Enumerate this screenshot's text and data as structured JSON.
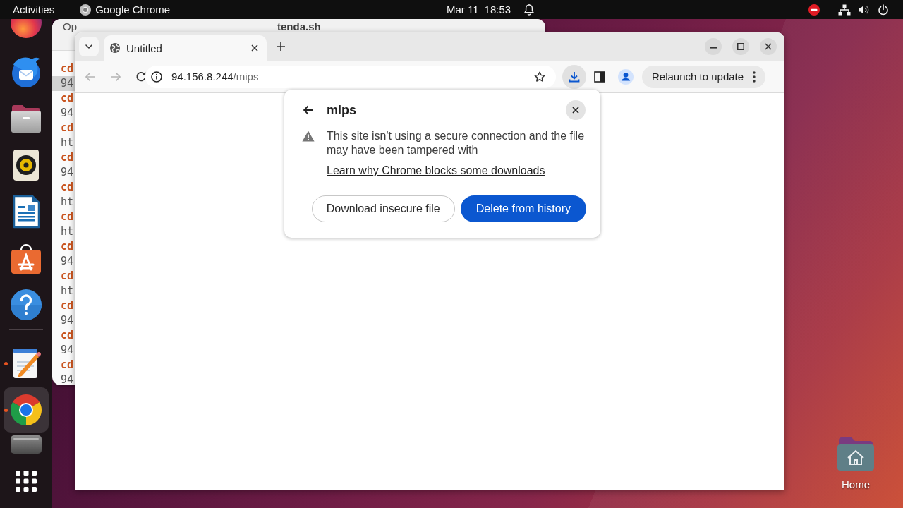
{
  "top_bar": {
    "activities": "Activities",
    "app_name": "Google Chrome",
    "date": "Mar 11",
    "time": "18:53"
  },
  "dock": {
    "favorites": [
      {
        "kind": "round",
        "running": false,
        "selected": false
      },
      {
        "kind": "mail",
        "running": false,
        "selected": false
      },
      {
        "kind": "folder",
        "running": false,
        "selected": false
      },
      {
        "kind": "speaker",
        "running": false,
        "selected": false
      },
      {
        "kind": "document",
        "running": false,
        "selected": false
      },
      {
        "kind": "bag",
        "running": false,
        "selected": false
      },
      {
        "kind": "help",
        "running": false,
        "selected": false
      }
    ],
    "open": [
      {
        "kind": "notepad",
        "running": true,
        "selected": false
      },
      {
        "kind": "browser",
        "running": true,
        "selected": true
      },
      {
        "kind": "drive",
        "running": false,
        "selected": false
      }
    ]
  },
  "editor_window": {
    "open_button": "Op",
    "title": "tenda.sh",
    "lines": [
      {
        "text": "cd",
        "kind": "keyword",
        "current": false
      },
      {
        "text": "94",
        "kind": "plain",
        "current": true
      },
      {
        "text": "cd",
        "kind": "keyword",
        "current": false
      },
      {
        "text": "94",
        "kind": "plain",
        "current": false
      },
      {
        "text": "cd",
        "kind": "keyword",
        "current": false
      },
      {
        "text": "ht",
        "kind": "plain",
        "current": false
      },
      {
        "text": "cd",
        "kind": "keyword",
        "current": false
      },
      {
        "text": "94",
        "kind": "plain",
        "current": false
      },
      {
        "text": "cd",
        "kind": "keyword",
        "current": false
      },
      {
        "text": "ht",
        "kind": "plain",
        "current": false
      },
      {
        "text": "cd",
        "kind": "keyword",
        "current": false
      },
      {
        "text": "ht",
        "kind": "plain",
        "current": false
      },
      {
        "text": "cd",
        "kind": "keyword",
        "current": false
      },
      {
        "text": "94",
        "kind": "plain",
        "current": false
      },
      {
        "text": "cd",
        "kind": "keyword",
        "current": false
      },
      {
        "text": "ht",
        "kind": "plain",
        "current": false
      },
      {
        "text": "cd",
        "kind": "keyword",
        "current": false
      },
      {
        "text": "94",
        "kind": "plain",
        "current": false
      },
      {
        "text": "cd",
        "kind": "keyword",
        "current": false
      },
      {
        "text": "94",
        "kind": "plain",
        "current": false
      },
      {
        "text": "cd",
        "kind": "keyword",
        "current": false
      },
      {
        "text": "94",
        "kind": "plain",
        "current": false
      }
    ]
  },
  "browser": {
    "tabs": [
      {
        "title": "Untitled",
        "selected": true
      }
    ],
    "nav_buttons": [
      {
        "kind": "back",
        "disabled": true
      },
      {
        "kind": "forward",
        "disabled": true
      },
      {
        "kind": "reload",
        "disabled": false
      }
    ],
    "address": {
      "host": "94.156.8.244",
      "path": "/mips"
    },
    "download_button": {
      "active": true
    },
    "relaunch_button": "Relaunch to update",
    "download_bubble": {
      "title": "mips",
      "message": "This site isn't using a secure connection and the file may have been tampered with",
      "link": "Learn why Chrome blocks some downloads",
      "buttons": [
        {
          "label": "Download insecure file",
          "kind": "secondary"
        },
        {
          "label": "Delete from history",
          "kind": "primary"
        }
      ]
    }
  },
  "desktop_icons": [
    {
      "label": "Home"
    }
  ]
}
